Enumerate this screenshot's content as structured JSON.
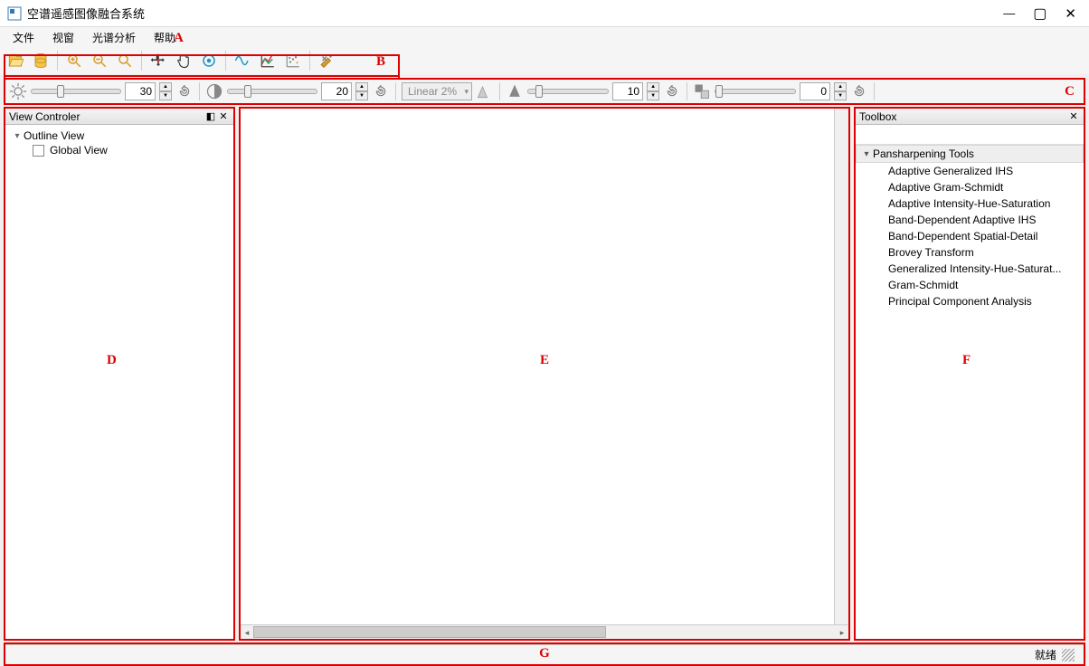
{
  "window": {
    "title": "空谱遥感图像融合系统"
  },
  "menus": {
    "file": "文件",
    "view": "视窗",
    "spectral": "光谱分析",
    "help": "帮助"
  },
  "labels": {
    "A": "A",
    "B": "B",
    "C": "C",
    "D": "D",
    "E": "E",
    "F": "F",
    "G": "G"
  },
  "ctrl": {
    "brightness_value": "30",
    "contrast_value": "20",
    "stretch_combo": "Linear 2%",
    "sharpen_value": "10",
    "transparency_value": "0"
  },
  "left_panel": {
    "title": "View Controler",
    "root": "Outline View",
    "child": "Global View"
  },
  "toolbox": {
    "title": "Toolbox",
    "category": "Pansharpening Tools",
    "items": [
      "Adaptive Generalized IHS",
      "Adaptive Gram-Schmidt",
      "Adaptive Intensity-Hue-Saturation",
      "Band-Dependent Adaptive IHS",
      "Band-Dependent Spatial-Detail",
      "Brovey Transform",
      "Generalized Intensity-Hue-Saturat...",
      "Gram-Schmidt",
      "Principal Component Analysis"
    ]
  },
  "status": {
    "ready": "就绪"
  }
}
